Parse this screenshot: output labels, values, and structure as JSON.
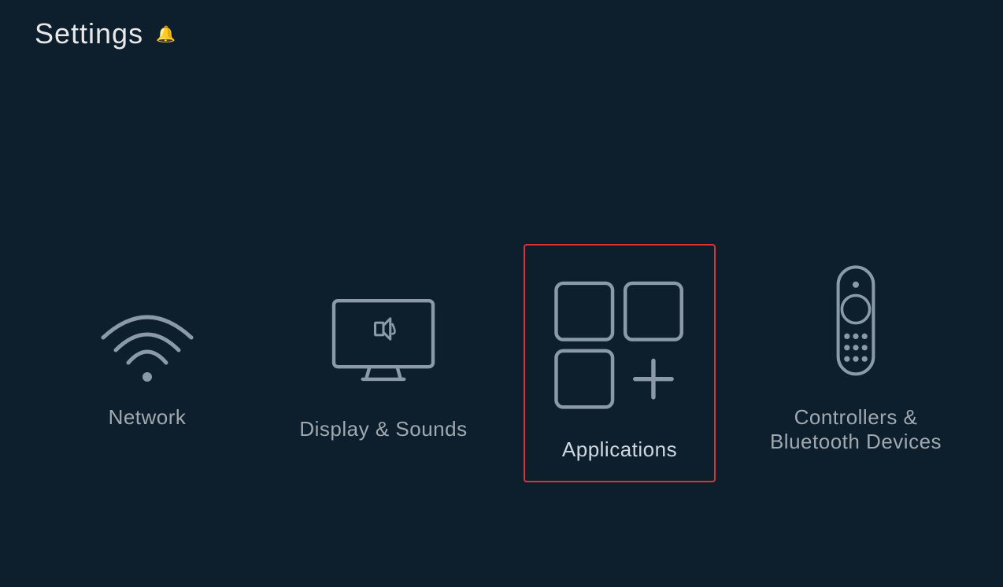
{
  "page": {
    "title": "Settings",
    "bell_icon": "🔔"
  },
  "items": [
    {
      "id": "network",
      "label": "Network",
      "selected": false
    },
    {
      "id": "display-sounds",
      "label": "Display & Sounds",
      "selected": false
    },
    {
      "id": "applications",
      "label": "Applications",
      "selected": true
    },
    {
      "id": "controllers-bluetooth",
      "label": "Controllers &\nBluetooth Devices",
      "selected": false
    }
  ],
  "colors": {
    "background": "#0d1f2d",
    "icon_stroke": "#8a9aa8",
    "selected_border": "#e03030",
    "label_normal": "#8a9aa8",
    "label_selected": "#c8d0d8",
    "title": "#e0e8f0"
  }
}
